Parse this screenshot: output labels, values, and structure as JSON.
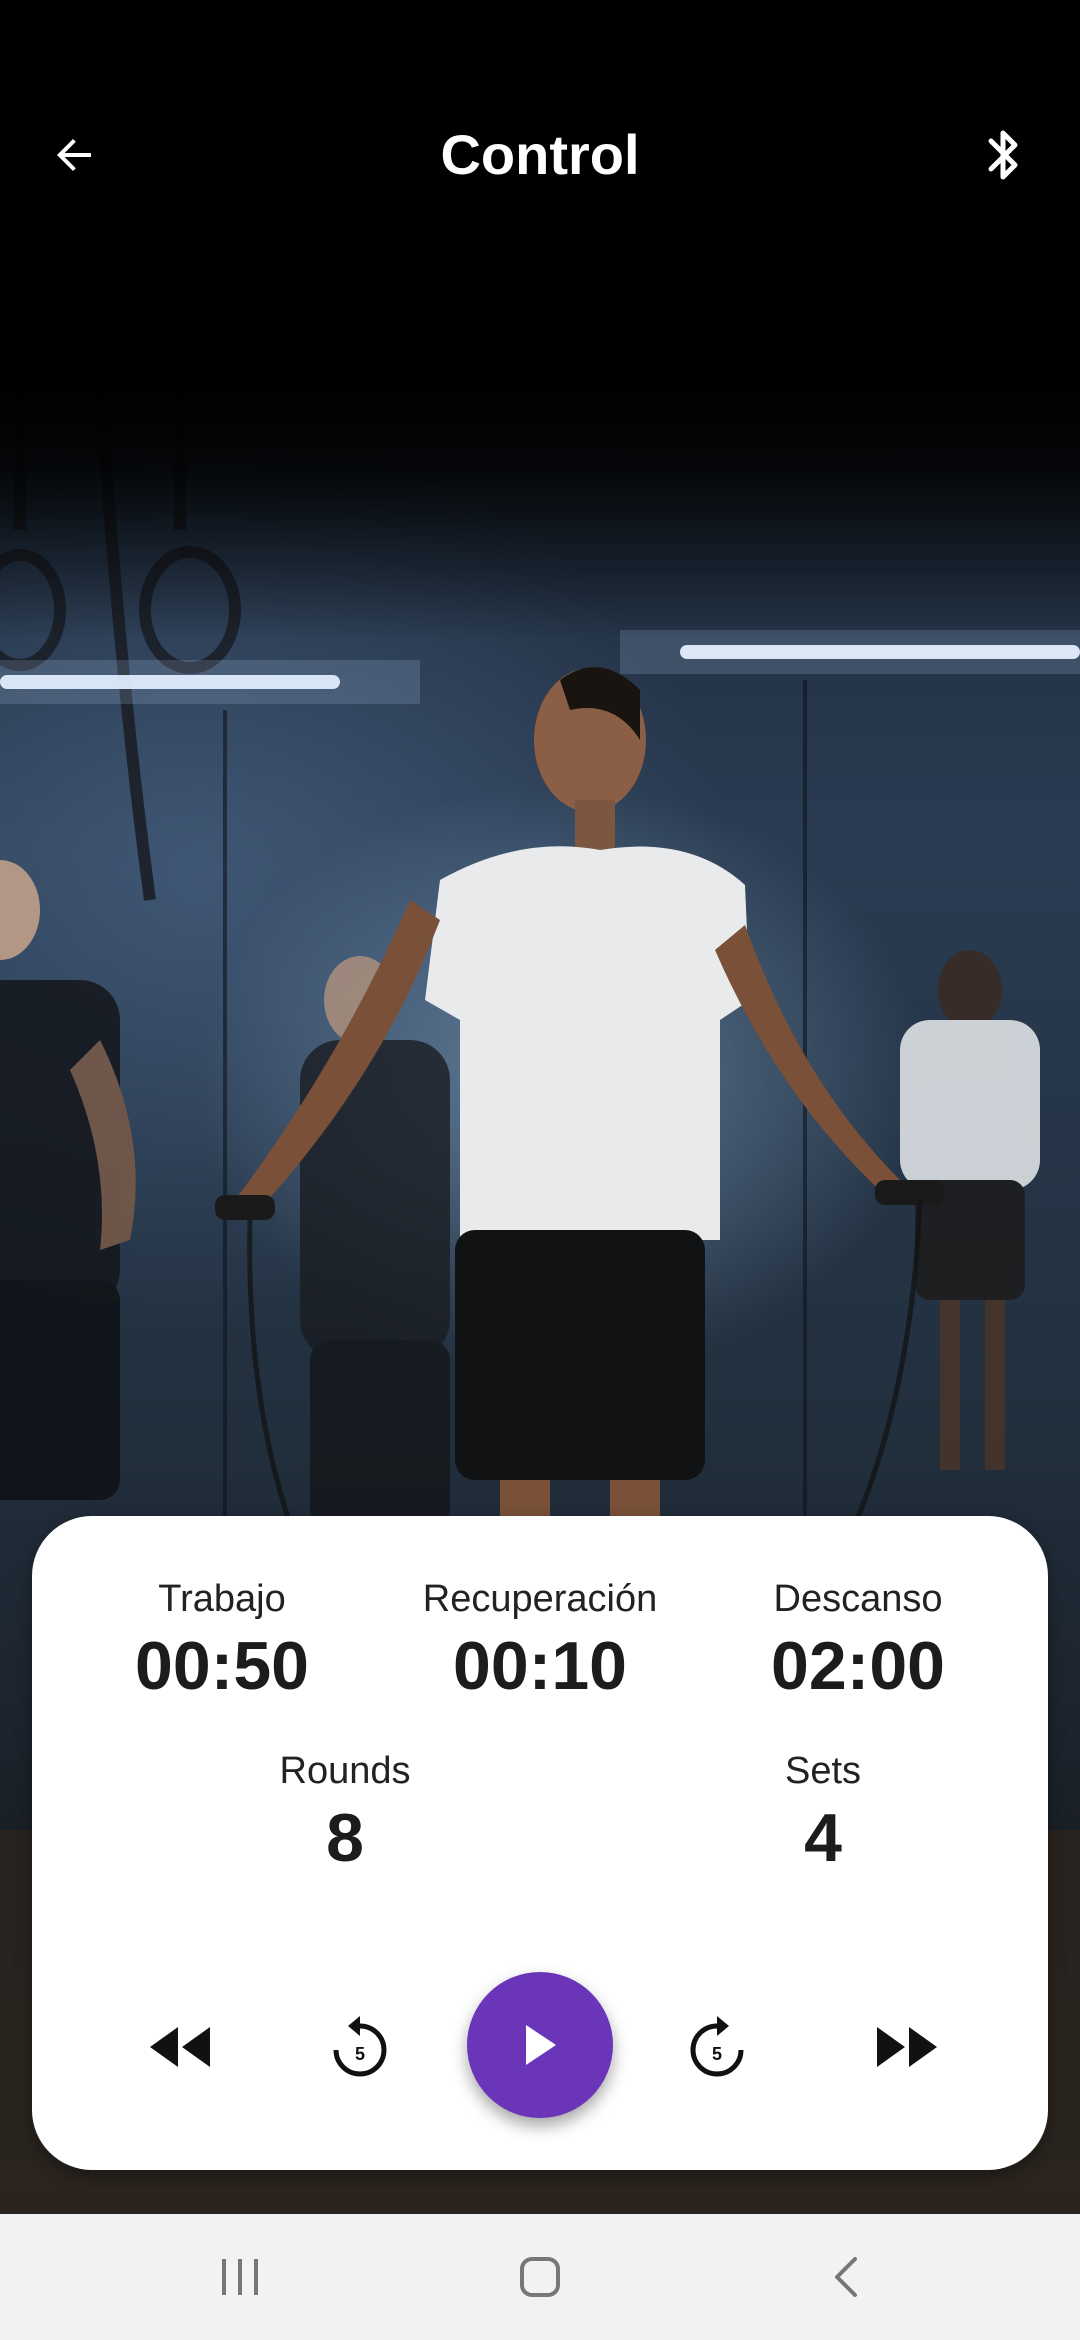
{
  "app_bar": {
    "title": "Control",
    "back_icon": "arrow-back-icon",
    "bluetooth_icon": "bluetooth-icon"
  },
  "stats": {
    "trabajo": {
      "label": "Trabajo",
      "value": "00:50"
    },
    "recuperacion": {
      "label": "Recuperación",
      "value": "00:10"
    },
    "descanso": {
      "label": "Descanso",
      "value": "02:00"
    },
    "rounds": {
      "label": "Rounds",
      "value": "8"
    },
    "sets": {
      "label": "Sets",
      "value": "4"
    }
  },
  "controls": {
    "rewind_icon": "fast-rewind-icon",
    "replay5_icon": "replay-5-icon",
    "replay5_text": "5",
    "play_icon": "play-icon",
    "forward5_icon": "forward-5-icon",
    "forward5_text": "5",
    "fast_forward_icon": "fast-forward-icon"
  },
  "colors": {
    "accent": "#6a35b8",
    "card_bg": "#ffffff",
    "app_bar_bg": "#000000",
    "nav_bar_bg": "#f2f2f2"
  },
  "nav_bar": {
    "recents_icon": "recents-icon",
    "home_icon": "home-icon",
    "back_icon": "nav-back-icon"
  }
}
